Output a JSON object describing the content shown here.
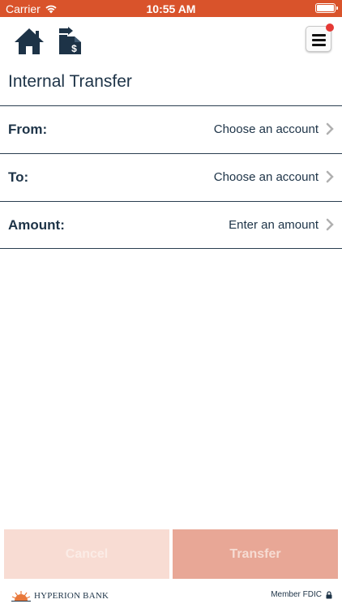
{
  "status_bar": {
    "carrier": "Carrier",
    "time": "10:55 AM"
  },
  "nav": {
    "home_icon": "home-icon",
    "transfer_icon": "money-transfer-icon",
    "menu_icon": "hamburger-menu-icon",
    "notification": "red-dot-badge"
  },
  "page": {
    "title": "Internal Transfer"
  },
  "form": {
    "from": {
      "label": "From:",
      "value": "Choose an account"
    },
    "to": {
      "label": "To:",
      "value": "Choose an account"
    },
    "amount": {
      "label": "Amount:",
      "value": "Enter an amount"
    }
  },
  "actions": {
    "cancel_label": "Cancel",
    "transfer_label": "Transfer"
  },
  "footer": {
    "bank_name": "HYPERION BANK",
    "fdic_text": "Member FDIC"
  },
  "colors": {
    "status_bar": "#d9532b",
    "primary_text": "#1d3347",
    "cancel_bg": "#f8dcd3",
    "transfer_bg": "#e8a796",
    "badge": "#e53935"
  }
}
